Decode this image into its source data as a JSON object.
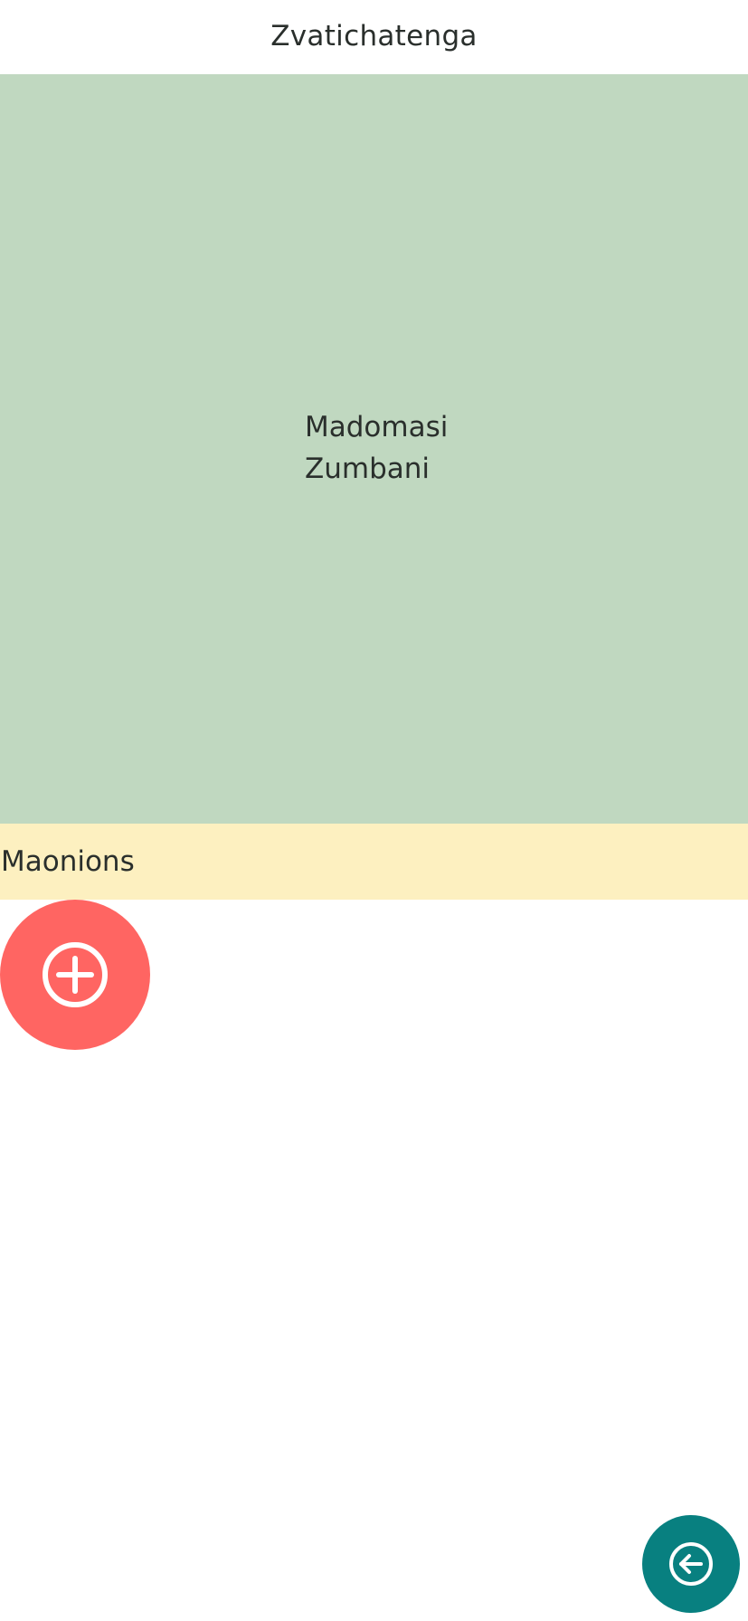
{
  "header": {
    "title": "Zvatichatenga"
  },
  "hero": {
    "line1": "Madomasi",
    "line2": "Zumbani",
    "background": "#c0d8c0"
  },
  "section": {
    "label": "Maonions",
    "background": "#fdf0c0"
  },
  "actions": {
    "add_icon": "plus-circle-icon",
    "add_color": "#ff6562",
    "back_icon": "arrow-left-circle-icon",
    "back_color": "#088080"
  }
}
